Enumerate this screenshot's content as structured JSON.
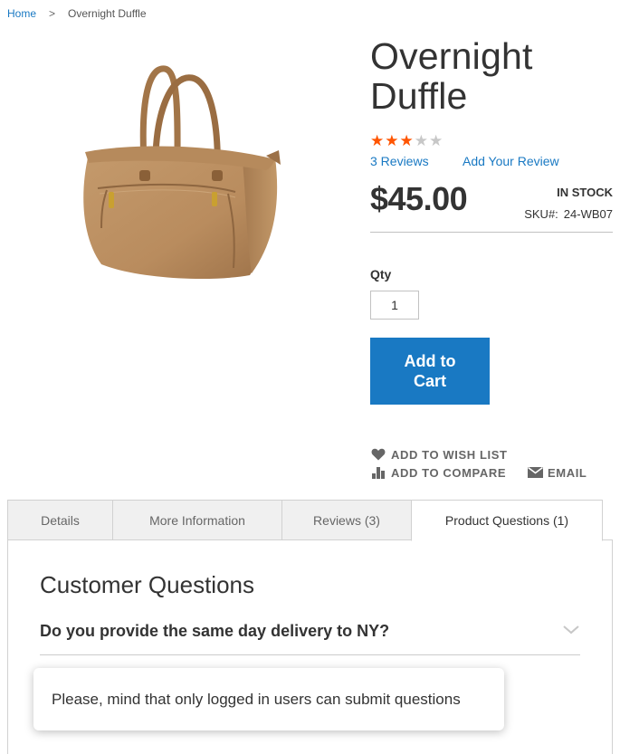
{
  "breadcrumb": {
    "home": "Home",
    "separator": ">",
    "current": "Overnight Duffle"
  },
  "product": {
    "title": "Overnight Duffle",
    "rating": {
      "value": 3,
      "max": 5,
      "color_on": "#ff5501",
      "color_off": "#c7c7c7"
    },
    "reviews_link": "3  Reviews",
    "add_review_link": "Add Your Review",
    "price": "$45.00",
    "stock": "IN STOCK",
    "sku_label": "SKU#:",
    "sku_value": "24-WB07",
    "image_icon": "tan-duffle-bag-image"
  },
  "cart": {
    "qty_label": "Qty",
    "qty_value": "1",
    "add_to_cart_line1": "Add to",
    "add_to_cart_line2": "Cart",
    "accent_color": "#1979c3"
  },
  "actions": {
    "wishlist": {
      "label": "ADD TO WISH LIST",
      "icon": "heart-icon"
    },
    "compare": {
      "label": "ADD TO COMPARE",
      "icon": "bar-chart-icon"
    },
    "email": {
      "label": "EMAIL",
      "icon": "envelope-icon"
    }
  },
  "tabs": [
    {
      "label": "Details",
      "active": false
    },
    {
      "label": "More Information",
      "active": false
    },
    {
      "label": "Reviews (3)",
      "active": false
    },
    {
      "label": "Product Questions (1)",
      "active": true
    }
  ],
  "questions": {
    "title": "Customer Questions",
    "items": [
      {
        "text": "Do you provide the same day delivery to NY?",
        "icon": "chevron-down-icon"
      }
    ]
  },
  "toast": {
    "message": "Please, mind that only logged in users can submit questions"
  }
}
